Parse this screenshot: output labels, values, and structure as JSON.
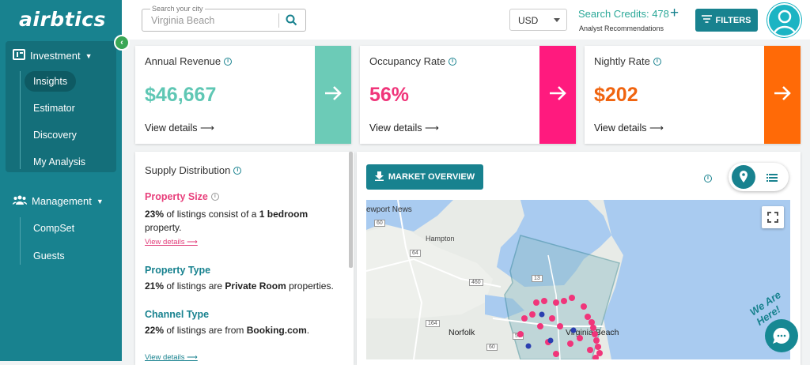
{
  "sidebar": {
    "logo": "airbtics",
    "groups": [
      {
        "label": "Investment",
        "icon": "analytics-icon",
        "items": [
          "Insights",
          "Estimator",
          "Discovery",
          "My Analysis"
        ],
        "active": "Insights"
      },
      {
        "label": "Management",
        "icon": "people-icon",
        "items": [
          "CompSet",
          "Guests"
        ]
      }
    ]
  },
  "topbar": {
    "search_label": "Search your city",
    "search_value": "Virginia Beach",
    "currency": "USD",
    "credits": "Search Credits: 478",
    "analyst": "Analyst Recommendations",
    "filters": "FILTERS"
  },
  "kpis": [
    {
      "title": "Annual Revenue",
      "value": "$46,667",
      "link": "View details",
      "color": "#5fc7b4",
      "accent": "#6ccbb7"
    },
    {
      "title": "Occupancy Rate",
      "value": "56%",
      "link": "View details",
      "color": "#f0357a",
      "accent": "#ff1a7e"
    },
    {
      "title": "Nightly Rate",
      "value": "$202",
      "link": "View details",
      "color": "#f0640f",
      "accent": "#ff6a07"
    }
  ],
  "supply": {
    "title": "Supply Distribution",
    "sections": [
      {
        "heading": "Property Size",
        "color": "#e8407c",
        "pct": "23%",
        "text_mid": " of listings consist of a ",
        "bold": "1 bedroom",
        "text_end": " property.",
        "link": "View details"
      },
      {
        "heading": "Property Type",
        "color": "#18828f",
        "pct": "21%",
        "text_mid": " of listings are ",
        "bold": "Private Room",
        "text_end": " properties."
      },
      {
        "heading": "Channel Type",
        "color": "#18828f",
        "pct": "22%",
        "text_mid": " of listings are from ",
        "bold": "Booking.com",
        "text_end": "."
      }
    ],
    "bottom_link": "View details"
  },
  "market": {
    "button": "MARKET OVERVIEW",
    "map_labels": [
      "ewport News",
      "Hampton",
      "Norfolk",
      "Virginia Beach"
    ],
    "road_labels": [
      "60",
      "64",
      "460",
      "13",
      "58",
      "164",
      "60"
    ]
  },
  "chat": {
    "label": "We Are Here!"
  }
}
